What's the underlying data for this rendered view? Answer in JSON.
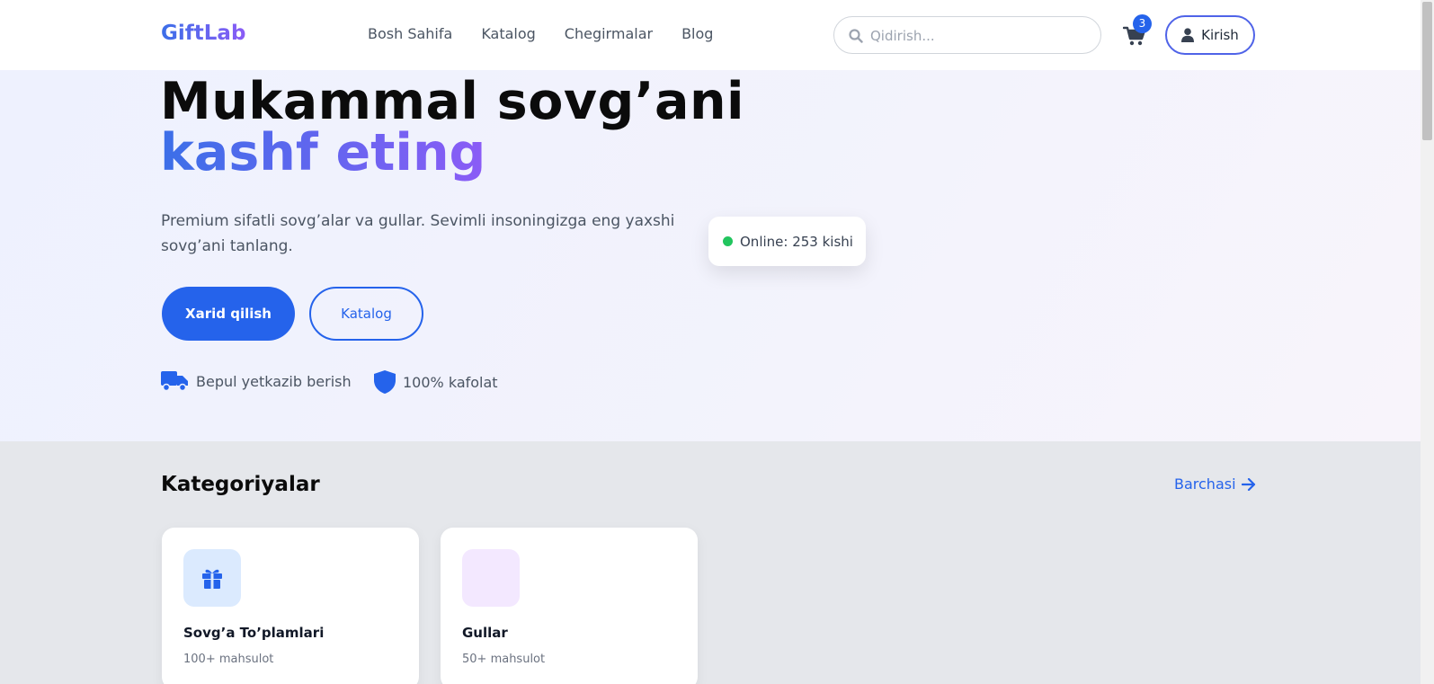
{
  "header": {
    "logo": "GiftLab",
    "nav": [
      "Bosh Sahifa",
      "Katalog",
      "Chegirmalar",
      "Blog"
    ],
    "search_placeholder": "Qidirish...",
    "cart_count": "3",
    "login_label": "Kirish"
  },
  "hero": {
    "title_line1": "Mukammal sovg’ani",
    "title_line2": "kashf eting",
    "description": "Premium sifatli sovg’alar va gullar. Sevimli insoningizga eng yaxshi sovg’ani tanlang.",
    "online_badge": "Online: 253 kishi",
    "primary_button": "Xarid qilish",
    "secondary_button": "Katalog",
    "features": [
      "Bepul yetkazib berish",
      "100% kafolat"
    ]
  },
  "categories": {
    "title": "Kategoriyalar",
    "see_all": "Barchasi",
    "items": [
      {
        "title": "Sovg’a To’plamlari",
        "subtitle": "100+ mahsulot",
        "icon": "gift-icon",
        "icon_bg": "#dbeafe",
        "icon_color": "#2563eb"
      },
      {
        "title": "Gullar",
        "subtitle": "50+ mahsulot",
        "icon": "flower-icon",
        "icon_bg": "#f3e8ff",
        "icon_color": "#a855f7"
      }
    ]
  },
  "colors": {
    "accent": "#2563eb",
    "gradient_start": "#3b6fe8",
    "gradient_end": "#8b5cf6",
    "online": "#22c55e"
  }
}
